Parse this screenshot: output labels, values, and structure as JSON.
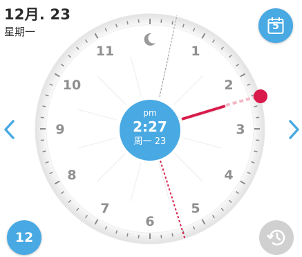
{
  "header": {
    "date": "12月. 23",
    "weekday": "星期一"
  },
  "calendar_button": {
    "icon": "calendar-icon",
    "day_number": "5"
  },
  "clock": {
    "ampm": "pm",
    "time": "2:27",
    "day_label": "周一 23",
    "hours": [
      "11",
      "1",
      "10",
      "2",
      "9",
      "3",
      "8",
      "4",
      "7",
      "5",
      "6"
    ],
    "hour_12_icon": "moon-icon",
    "accent_color": "#49a9e3",
    "hand_color": "#d81b4a"
  },
  "bottom_left_badge": {
    "value": "12"
  },
  "history_button": {
    "icon": "history-icon"
  },
  "navigation": {
    "prev_icon": "chevron-left-icon",
    "next_icon": "chevron-right-icon"
  }
}
